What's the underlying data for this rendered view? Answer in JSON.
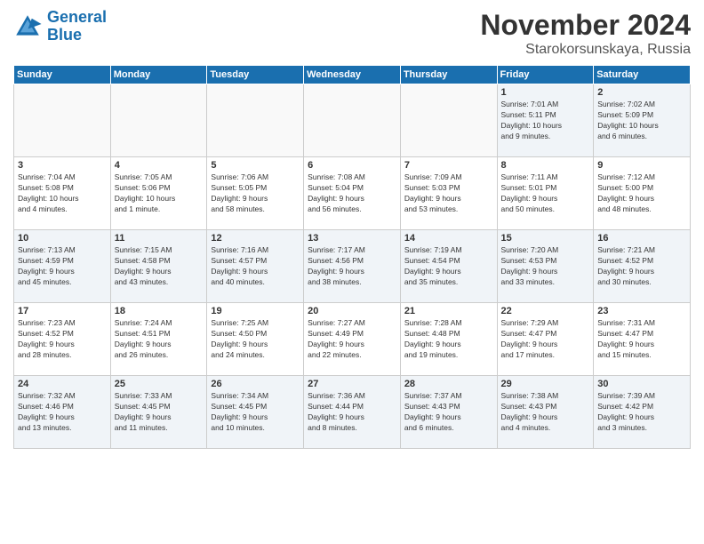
{
  "logo": {
    "line1": "General",
    "line2": "Blue"
  },
  "title": "November 2024",
  "location": "Starokorsunskaya, Russia",
  "weekdays": [
    "Sunday",
    "Monday",
    "Tuesday",
    "Wednesday",
    "Thursday",
    "Friday",
    "Saturday"
  ],
  "weeks": [
    [
      {
        "day": "",
        "info": ""
      },
      {
        "day": "",
        "info": ""
      },
      {
        "day": "",
        "info": ""
      },
      {
        "day": "",
        "info": ""
      },
      {
        "day": "",
        "info": ""
      },
      {
        "day": "1",
        "info": "Sunrise: 7:01 AM\nSunset: 5:11 PM\nDaylight: 10 hours\nand 9 minutes."
      },
      {
        "day": "2",
        "info": "Sunrise: 7:02 AM\nSunset: 5:09 PM\nDaylight: 10 hours\nand 6 minutes."
      }
    ],
    [
      {
        "day": "3",
        "info": "Sunrise: 7:04 AM\nSunset: 5:08 PM\nDaylight: 10 hours\nand 4 minutes."
      },
      {
        "day": "4",
        "info": "Sunrise: 7:05 AM\nSunset: 5:06 PM\nDaylight: 10 hours\nand 1 minute."
      },
      {
        "day": "5",
        "info": "Sunrise: 7:06 AM\nSunset: 5:05 PM\nDaylight: 9 hours\nand 58 minutes."
      },
      {
        "day": "6",
        "info": "Sunrise: 7:08 AM\nSunset: 5:04 PM\nDaylight: 9 hours\nand 56 minutes."
      },
      {
        "day": "7",
        "info": "Sunrise: 7:09 AM\nSunset: 5:03 PM\nDaylight: 9 hours\nand 53 minutes."
      },
      {
        "day": "8",
        "info": "Sunrise: 7:11 AM\nSunset: 5:01 PM\nDaylight: 9 hours\nand 50 minutes."
      },
      {
        "day": "9",
        "info": "Sunrise: 7:12 AM\nSunset: 5:00 PM\nDaylight: 9 hours\nand 48 minutes."
      }
    ],
    [
      {
        "day": "10",
        "info": "Sunrise: 7:13 AM\nSunset: 4:59 PM\nDaylight: 9 hours\nand 45 minutes."
      },
      {
        "day": "11",
        "info": "Sunrise: 7:15 AM\nSunset: 4:58 PM\nDaylight: 9 hours\nand 43 minutes."
      },
      {
        "day": "12",
        "info": "Sunrise: 7:16 AM\nSunset: 4:57 PM\nDaylight: 9 hours\nand 40 minutes."
      },
      {
        "day": "13",
        "info": "Sunrise: 7:17 AM\nSunset: 4:56 PM\nDaylight: 9 hours\nand 38 minutes."
      },
      {
        "day": "14",
        "info": "Sunrise: 7:19 AM\nSunset: 4:54 PM\nDaylight: 9 hours\nand 35 minutes."
      },
      {
        "day": "15",
        "info": "Sunrise: 7:20 AM\nSunset: 4:53 PM\nDaylight: 9 hours\nand 33 minutes."
      },
      {
        "day": "16",
        "info": "Sunrise: 7:21 AM\nSunset: 4:52 PM\nDaylight: 9 hours\nand 30 minutes."
      }
    ],
    [
      {
        "day": "17",
        "info": "Sunrise: 7:23 AM\nSunset: 4:52 PM\nDaylight: 9 hours\nand 28 minutes."
      },
      {
        "day": "18",
        "info": "Sunrise: 7:24 AM\nSunset: 4:51 PM\nDaylight: 9 hours\nand 26 minutes."
      },
      {
        "day": "19",
        "info": "Sunrise: 7:25 AM\nSunset: 4:50 PM\nDaylight: 9 hours\nand 24 minutes."
      },
      {
        "day": "20",
        "info": "Sunrise: 7:27 AM\nSunset: 4:49 PM\nDaylight: 9 hours\nand 22 minutes."
      },
      {
        "day": "21",
        "info": "Sunrise: 7:28 AM\nSunset: 4:48 PM\nDaylight: 9 hours\nand 19 minutes."
      },
      {
        "day": "22",
        "info": "Sunrise: 7:29 AM\nSunset: 4:47 PM\nDaylight: 9 hours\nand 17 minutes."
      },
      {
        "day": "23",
        "info": "Sunrise: 7:31 AM\nSunset: 4:47 PM\nDaylight: 9 hours\nand 15 minutes."
      }
    ],
    [
      {
        "day": "24",
        "info": "Sunrise: 7:32 AM\nSunset: 4:46 PM\nDaylight: 9 hours\nand 13 minutes."
      },
      {
        "day": "25",
        "info": "Sunrise: 7:33 AM\nSunset: 4:45 PM\nDaylight: 9 hours\nand 11 minutes."
      },
      {
        "day": "26",
        "info": "Sunrise: 7:34 AM\nSunset: 4:45 PM\nDaylight: 9 hours\nand 10 minutes."
      },
      {
        "day": "27",
        "info": "Sunrise: 7:36 AM\nSunset: 4:44 PM\nDaylight: 9 hours\nand 8 minutes."
      },
      {
        "day": "28",
        "info": "Sunrise: 7:37 AM\nSunset: 4:43 PM\nDaylight: 9 hours\nand 6 minutes."
      },
      {
        "day": "29",
        "info": "Sunrise: 7:38 AM\nSunset: 4:43 PM\nDaylight: 9 hours\nand 4 minutes."
      },
      {
        "day": "30",
        "info": "Sunrise: 7:39 AM\nSunset: 4:42 PM\nDaylight: 9 hours\nand 3 minutes."
      }
    ]
  ]
}
